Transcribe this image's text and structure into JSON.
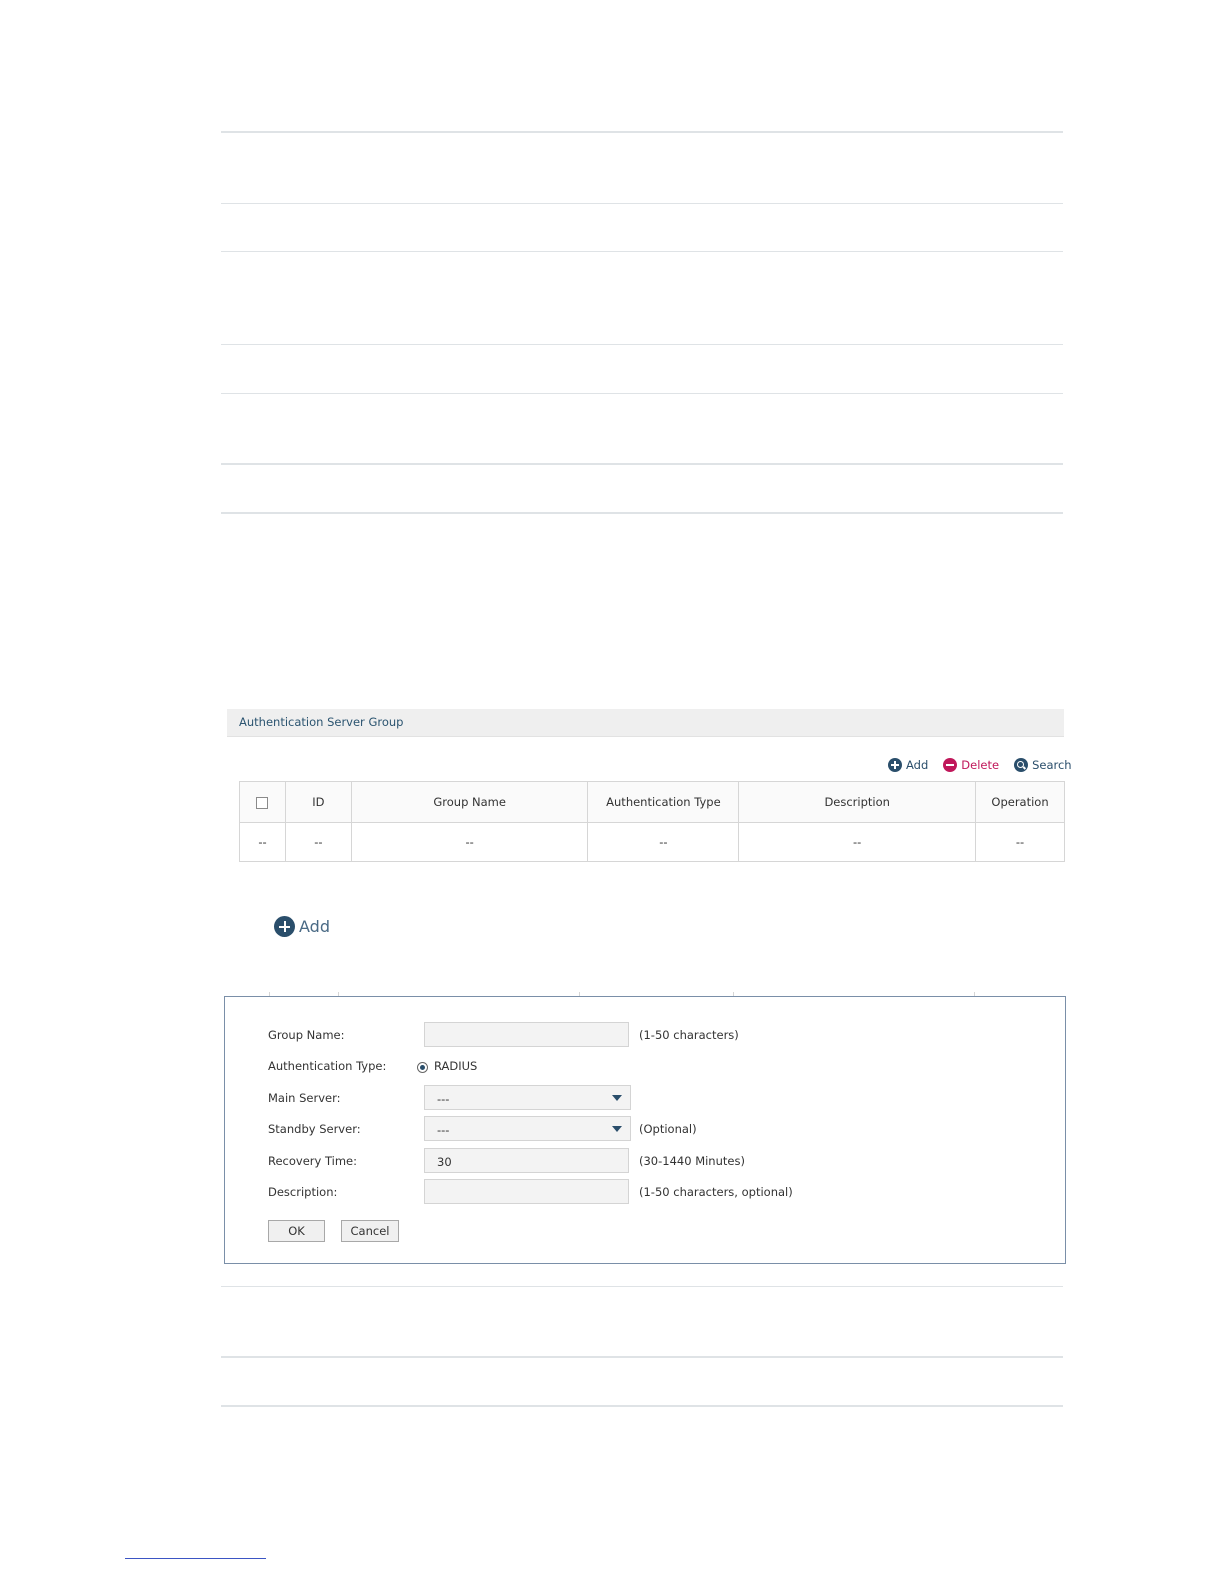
{
  "panel": {
    "title": "Authentication Server Group"
  },
  "toolbar": {
    "add_label": "Add",
    "delete_label": "Delete",
    "search_label": "Search"
  },
  "table": {
    "headers": [
      "ID",
      "Group Name",
      "Authentication Type",
      "Description",
      "Operation"
    ],
    "row": [
      "--",
      "--",
      "--",
      "--",
      "--",
      "--"
    ]
  },
  "big_add": {
    "label": "Add"
  },
  "form": {
    "group_name": {
      "label": "Group Name:",
      "value": "",
      "hint": "(1-50 characters)"
    },
    "auth_type": {
      "label": "Authentication Type:",
      "option": "RADIUS"
    },
    "main_server": {
      "label": "Main Server:",
      "value": "---"
    },
    "standby_server": {
      "label": "Standby Server:",
      "value": "---",
      "hint": "(Optional)"
    },
    "recovery_time": {
      "label": "Recovery Time:",
      "value": "30",
      "hint": "(30-1440 Minutes)"
    },
    "description": {
      "label": "Description:",
      "value": "",
      "hint": "(1-50 characters, optional)"
    },
    "ok_label": "OK",
    "cancel_label": "Cancel"
  },
  "colors": {
    "accent": "#2a4e6b",
    "delete": "#c0175a",
    "link": "#3b55c4"
  }
}
